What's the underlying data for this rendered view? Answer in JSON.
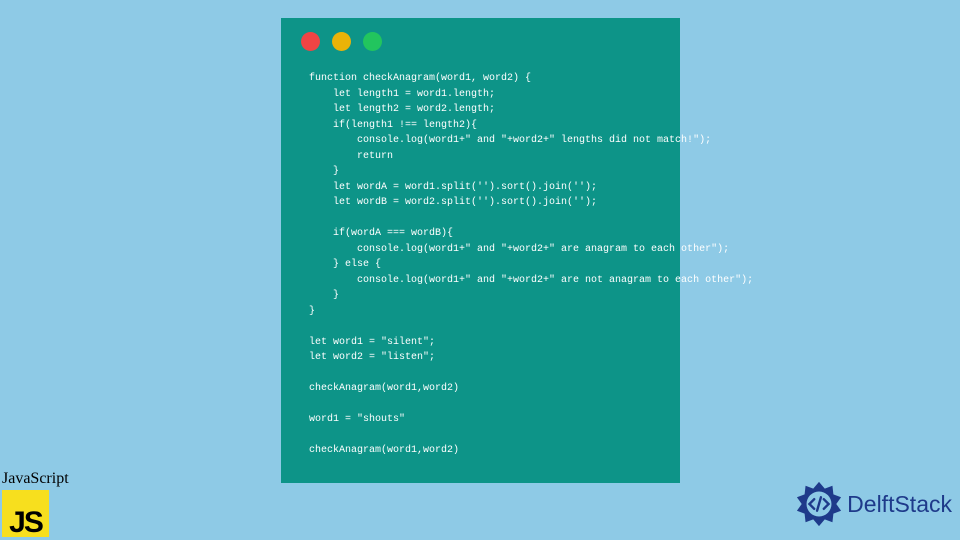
{
  "window": {
    "trafficLights": [
      "red",
      "yellow",
      "green"
    ]
  },
  "code": "function checkAnagram(word1, word2) {\n    let length1 = word1.length;\n    let length2 = word2.length;\n    if(length1 !== length2){\n        console.log(word1+\" and \"+word2+\" lengths did not match!\");\n        return\n    }\n    let wordA = word1.split('').sort().join('');\n    let wordB = word2.split('').sort().join('');\n\n    if(wordA === wordB){\n        console.log(word1+\" and \"+word2+\" are anagram to each other\");\n    } else {\n        console.log(word1+\" and \"+word2+\" are not anagram to each other\");\n    }\n}\n\nlet word1 = \"silent\";\nlet word2 = \"listen\";\n\ncheckAnagram(word1,word2)\n\nword1 = \"shouts\"\n\ncheckAnagram(word1,word2)",
  "badges": {
    "js": {
      "label": "JavaScript",
      "logoText": "JS"
    },
    "delft": {
      "text": "DelftStack"
    }
  },
  "colors": {
    "bg": "#8ecae6",
    "windowBg": "#0d9488",
    "jsYellow": "#f7df1e",
    "delftBlue": "#1e3a8a"
  }
}
